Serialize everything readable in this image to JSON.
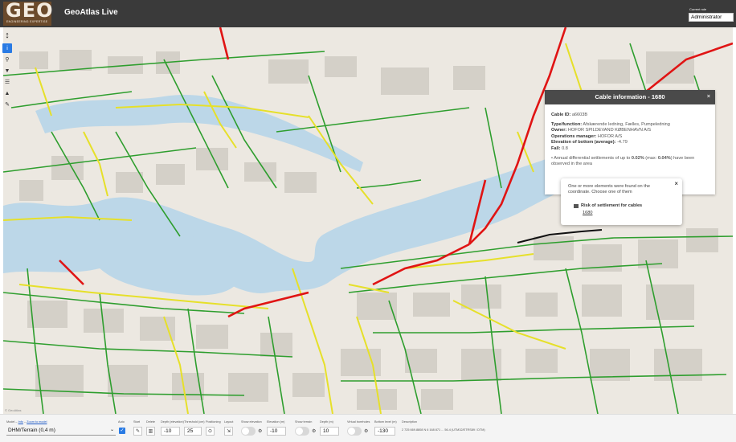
{
  "header": {
    "logo_text": "GEO",
    "logo_subtitle": "ENGINEERING EXPERTISE",
    "app_title": "GeoAtlas Live",
    "role_label": "Current role",
    "role_value": "Administrator",
    "background": "#3a3a3a",
    "logo_color": "#6b4a2b"
  },
  "toolbar": {
    "items": [
      {
        "icon": "info-icon",
        "glyph": "i"
      },
      {
        "icon": "search-icon",
        "glyph": "⚲"
      },
      {
        "icon": "filter-icon",
        "glyph": "▼"
      },
      {
        "icon": "layers-icon",
        "glyph": "☰"
      },
      {
        "icon": "location-icon",
        "glyph": "▲"
      },
      {
        "icon": "ruler-icon",
        "glyph": "✎"
      }
    ]
  },
  "cable_panel": {
    "title": "Cable information - 1680",
    "close_glyph": "×",
    "cable_id_label": "Cable ID:",
    "cable_id": "a6603B",
    "type_label": "Type/function:",
    "type_value": "Afskærende ledning, Fælles, Pumpeledning",
    "owner_label": "Owner:",
    "owner_value": "HOFOR SPILDEVAND KØBENHAVN A/S",
    "ops_label": "Operations manager:",
    "ops_value": "HOFOR A/S",
    "elev_label": "Elevation of bottom (average):",
    "elev_value": "-4.79",
    "fall_label": "Fall:",
    "fall_value": "0.8",
    "settle_pre": "Annual differential settlements of up to",
    "settle_val": "0.02%",
    "settle_mid": "(max:",
    "settle_max": "0.04%",
    "settle_post": ") have been observed in the area"
  },
  "popup": {
    "message": "One or more elements were found on the coordinate. Choose one of them",
    "layer_name": "Risk of settlement for cables",
    "link_text": "1680",
    "close_glyph": "×"
  },
  "bottom_bar": {
    "model_label": "Model",
    "info_link": "Info",
    "zoom_link": "Zoom to model",
    "model_value": "DHM/Terrain (0,4 m)",
    "auto_label": "Auto",
    "start_label": "Start",
    "delete_label": "Delete",
    "depth_label": "Depth (elevation)",
    "depth_value": "-10",
    "threshold_label": "Threshold (cm)",
    "threshold_value": "25",
    "positioning_label": "Positioning",
    "layout_label": "Layout",
    "show_elev_label": "Show elevation",
    "elev_label": "Elevation (m)",
    "elev_value": "-10",
    "show_terrain_label": "Show terrain",
    "depth_m_label": "Depth (m)",
    "depth_m_value": "10",
    "virtual_label": "Virtual boreholes",
    "bottom_level_label": "Bottom level (m)",
    "bottom_level_value": "-130",
    "desc_label": "Description",
    "desc_value": "2 725 669.8808 N 6 168 871 ... 56.4 (UTM32/ETRS89 / DTM)"
  },
  "map": {
    "attribution": "© GeoAtlas",
    "colors": {
      "water": "#bcd7e8",
      "land": "#ece8e1",
      "block": "#d4d0c8",
      "green": "#2e9e2e",
      "yellow": "#e6e02a",
      "red": "#e01414"
    }
  }
}
